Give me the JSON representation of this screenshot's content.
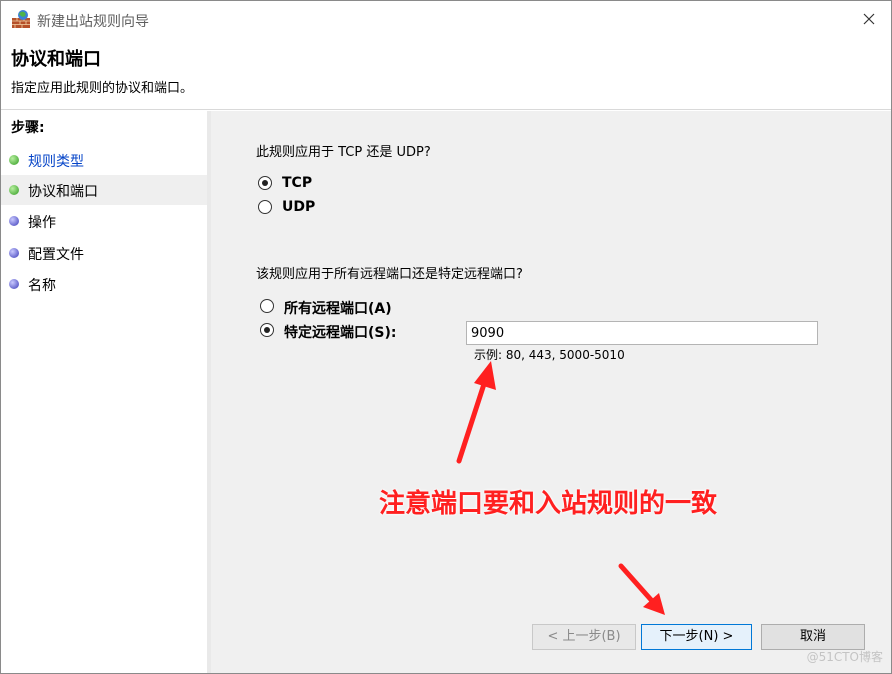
{
  "window": {
    "title": "新建出站规则向导"
  },
  "header": {
    "title": "协议和端口",
    "description": "指定应用此规则的协议和端口。"
  },
  "sidebar": {
    "steps_label": "步骤:",
    "items": [
      {
        "label": "规则类型",
        "status": "done"
      },
      {
        "label": "协议和端口",
        "status": "current"
      },
      {
        "label": "操作",
        "status": "todo"
      },
      {
        "label": "配置文件",
        "status": "todo"
      },
      {
        "label": "名称",
        "status": "todo"
      }
    ]
  },
  "protocol": {
    "question": "此规则应用于 TCP 还是 UDP?",
    "options": [
      {
        "label": "TCP",
        "selected": true
      },
      {
        "label": "UDP",
        "selected": false
      }
    ]
  },
  "ports": {
    "question": "该规则应用于所有远程端口还是特定远程端口?",
    "options": [
      {
        "label": "所有远程端口(A)",
        "selected": false
      },
      {
        "label": "特定远程端口(S):",
        "selected": true
      }
    ],
    "input_value": "9090",
    "example": "示例: 80, 443, 5000-5010"
  },
  "annotation": {
    "text": "注意端口要和入站规则的一致",
    "color": "#ff2020"
  },
  "buttons": {
    "back": "< 上一步(B)",
    "next": "下一步(N) >",
    "cancel": "取消"
  },
  "watermark": "@51CTO博客",
  "icons": {
    "app": "firewall-icon",
    "close": "close-icon"
  }
}
